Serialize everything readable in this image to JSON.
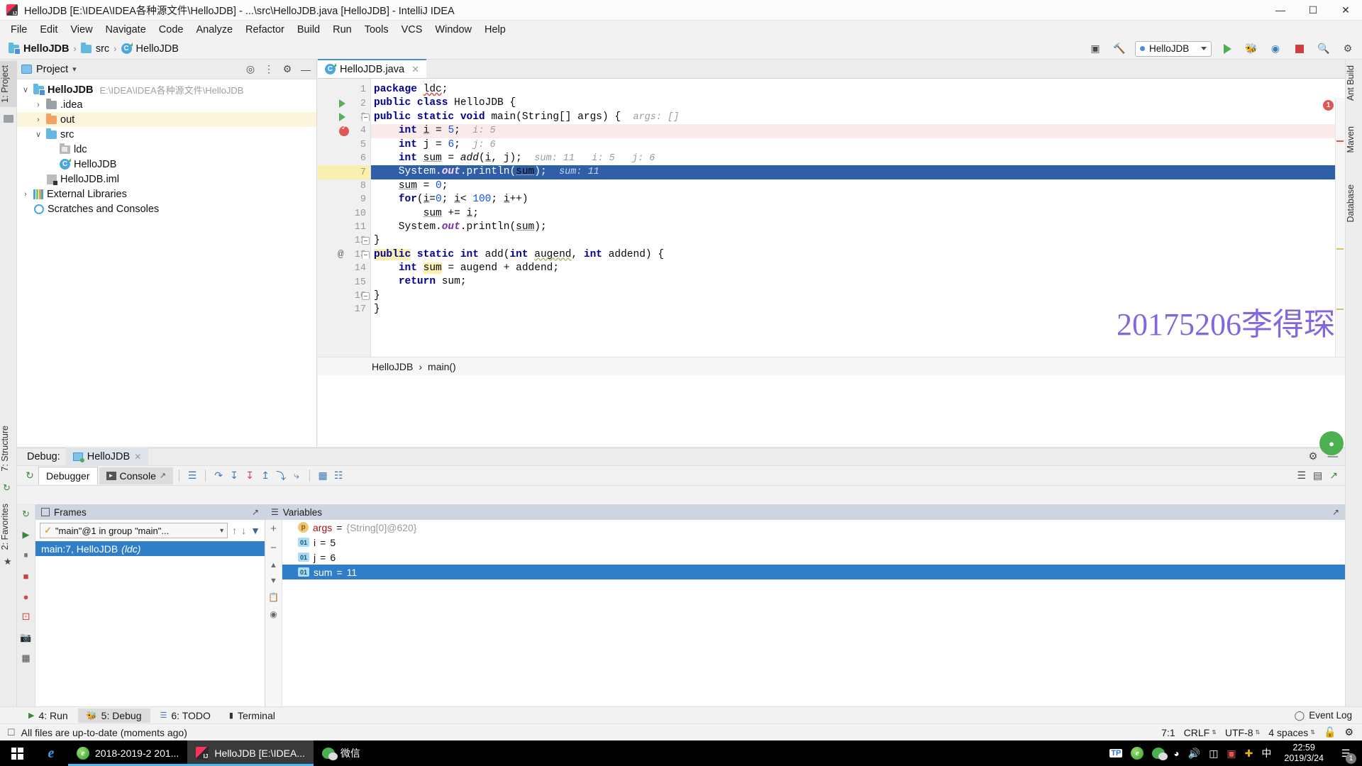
{
  "window": {
    "title": "HelloJDB [E:\\IDEA\\IDEA各种源文件\\HelloJDB] - ...\\src\\HelloJDB.java [HelloJDB] - IntelliJ IDEA",
    "minimize_label": "—",
    "maximize_label": "☐",
    "close_label": "✕"
  },
  "menubar": {
    "items": [
      "File",
      "Edit",
      "View",
      "Navigate",
      "Code",
      "Analyze",
      "Refactor",
      "Build",
      "Run",
      "Tools",
      "VCS",
      "Window",
      "Help"
    ]
  },
  "navbar": {
    "crumbs": [
      {
        "label": "HelloJDB",
        "icon": "module-folder-icon"
      },
      {
        "label": "src",
        "icon": "folder-icon"
      },
      {
        "label": "HelloJDB",
        "icon": "java-class-icon"
      }
    ],
    "separator": "›",
    "run_config": "HelloJDB",
    "icons": {
      "layout": "restore-layout-icon",
      "build": "hammer-icon",
      "run": "run-icon",
      "debug": "debug-icon",
      "coverage": "run-with-coverage-icon",
      "stop": "stop-icon",
      "search": "search-everywhere-icon",
      "settings": "settings-icon"
    }
  },
  "left_strip": {
    "project_label": "1: Project",
    "structure_label": "7: Structure",
    "favorites_label": "2: Favorites"
  },
  "right_strip": {
    "ant_label": "Ant Build",
    "maven_label": "Maven",
    "database_label": "Database"
  },
  "project_panel": {
    "title": "Project",
    "dropdown_caret": "▾",
    "header_icons": [
      "locate-icon",
      "collapse-all-icon",
      "gear-icon",
      "hide-icon"
    ],
    "tree": [
      {
        "label": "HelloJDB",
        "path": "E:\\IDEA\\IDEA各种源文件\\HelloJDB",
        "indent": 0,
        "arrow": "∨",
        "icon": "module-folder-icon",
        "bold": true,
        "highlight": false
      },
      {
        "label": ".idea",
        "path": "",
        "indent": 1,
        "arrow": "›",
        "icon": "folder-grey-icon",
        "bold": false,
        "highlight": false
      },
      {
        "label": "out",
        "path": "",
        "indent": 1,
        "arrow": "›",
        "icon": "folder-orange-icon",
        "bold": false,
        "highlight": true
      },
      {
        "label": "src",
        "path": "",
        "indent": 1,
        "arrow": "∨",
        "icon": "folder-blue-icon",
        "bold": false,
        "highlight": false
      },
      {
        "label": "ldc",
        "path": "",
        "indent": 2,
        "arrow": "",
        "icon": "package-icon",
        "bold": false,
        "highlight": false
      },
      {
        "label": "HelloJDB",
        "path": "",
        "indent": 2,
        "arrow": "",
        "icon": "java-class-icon",
        "bold": false,
        "highlight": false
      },
      {
        "label": "HelloJDB.iml",
        "path": "",
        "indent": 1,
        "arrow": "",
        "icon": "iml-file-icon",
        "bold": false,
        "highlight": false
      },
      {
        "label": "External Libraries",
        "path": "",
        "indent": 0,
        "arrow": "›",
        "icon": "library-icon",
        "bold": false,
        "highlight": false
      },
      {
        "label": "Scratches and Consoles",
        "path": "",
        "indent": 0,
        "arrow": "",
        "icon": "scratch-icon",
        "bold": false,
        "highlight": false
      }
    ]
  },
  "editor": {
    "tab_label": "HelloJDB.java",
    "tab_close": "✕",
    "error_count": "1",
    "watermark": "20175206李得琛",
    "breadcrumb": [
      "HelloJDB",
      "main()"
    ],
    "breadcrumb_sep": "›",
    "lines": [
      {
        "n": "1",
        "marker": "",
        "fold": "",
        "state": "normal"
      },
      {
        "n": "2",
        "marker": "run-gutter-icon",
        "fold": "",
        "state": "normal"
      },
      {
        "n": "3",
        "marker": "run-gutter-icon",
        "fold": "half",
        "state": "normal"
      },
      {
        "n": "4",
        "marker": "breakpoint-verified-icon",
        "fold": "",
        "state": "breakpoint"
      },
      {
        "n": "5",
        "marker": "",
        "fold": "",
        "state": "normal"
      },
      {
        "n": "6",
        "marker": "",
        "fold": "",
        "state": "normal"
      },
      {
        "n": "7",
        "marker": "",
        "fold": "",
        "state": "executing"
      },
      {
        "n": "8",
        "marker": "",
        "fold": "",
        "state": "normal"
      },
      {
        "n": "9",
        "marker": "",
        "fold": "",
        "state": "normal"
      },
      {
        "n": "10",
        "marker": "",
        "fold": "",
        "state": "normal"
      },
      {
        "n": "11",
        "marker": "",
        "fold": "",
        "state": "normal"
      },
      {
        "n": "12",
        "marker": "",
        "fold": "end",
        "state": "normal"
      },
      {
        "n": "13",
        "marker": "@",
        "fold": "half",
        "state": "normal"
      },
      {
        "n": "14",
        "marker": "",
        "fold": "",
        "state": "normal"
      },
      {
        "n": "15",
        "marker": "",
        "fold": "",
        "state": "normal"
      },
      {
        "n": "16",
        "marker": "",
        "fold": "end",
        "state": "normal"
      },
      {
        "n": "17",
        "marker": "",
        "fold": "",
        "state": "normal"
      }
    ],
    "source": {
      "l1": "package ldc;",
      "l2": "public class HelloJDB {",
      "l3": "public static void main(String[] args) {",
      "l3_hint": "args: []",
      "l4": "int i = 5;",
      "l4_hint": "i: 5",
      "l5": "int j = 6;",
      "l5_hint": "j: 6",
      "l6": "int sum = add(i, j);",
      "l6_hint": "sum: 11   i: 5   j: 6",
      "l7": "System.out.println(sum);",
      "l7_hint": "sum: 11",
      "l8": "sum = 0;",
      "l9": "for(i=0; i< 100; i++)",
      "l10": "sum += i;",
      "l11": "System.out.println(sum);",
      "l12": "}",
      "l13": "public static int add(int augend, int addend) {",
      "l14": "int sum = augend + addend;",
      "l15": "return sum;",
      "l16": "}",
      "l17": "}"
    }
  },
  "debug": {
    "header_label": "Debug:",
    "session_tab": "HelloJDB",
    "session_close": "✕",
    "tabs": [
      {
        "label": "Debugger",
        "active": true,
        "icon": "debugger-icon"
      },
      {
        "label": "Console",
        "active": false,
        "icon": "console-icon"
      }
    ],
    "toolbar_icons": [
      "rerun-icon",
      "mute-breakpoints-icon",
      "step-over-icon",
      "step-into-icon",
      "force-step-into-icon",
      "step-out-icon",
      "drop-frame-icon",
      "run-to-cursor-icon",
      "evaluate-expression-icon",
      "layout-icon"
    ],
    "settings_icon": "settings-icon",
    "hide_icon": "hide-icon",
    "side_icons": [
      "rerun-icon",
      "resume-icon",
      "pause-icon",
      "stop-icon",
      "view-breakpoints-icon",
      "mute-breakpoints-icon",
      "screenshot-icon",
      "layers-icon"
    ],
    "frames": {
      "title": "Frames",
      "thread": "\"main\"@1 in group \"main\"...",
      "thread_caret": "∨",
      "check_icon": "checkmark-icon",
      "nav_icons": [
        "arrow-up-icon",
        "arrow-down-icon",
        "filter-icon"
      ],
      "rows": [
        {
          "label": "main:7, HelloJDB",
          "module": "(ldc)",
          "selected": true
        }
      ]
    },
    "variables": {
      "title": "Variables",
      "side_buttons": [
        "plus-icon",
        "minus-icon",
        "arrow-up-icon",
        "arrow-down-icon",
        "copy-icon",
        "watch-icon"
      ],
      "rows": [
        {
          "icon": "p",
          "name": "args",
          "eq": "=",
          "value": "{String[0]@620}",
          "selected": false
        },
        {
          "icon": "01",
          "name": "i",
          "eq": "=",
          "value": "5",
          "selected": false
        },
        {
          "icon": "01",
          "name": "j",
          "eq": "=",
          "value": "6",
          "selected": false
        },
        {
          "icon": "01",
          "name": "sum",
          "eq": "=",
          "value": "11",
          "selected": true
        }
      ]
    }
  },
  "bottom_tabs": {
    "items": [
      {
        "label": "4: Run",
        "active": false,
        "icon": "run-icon"
      },
      {
        "label": "5: Debug",
        "active": true,
        "icon": "debug-icon"
      },
      {
        "label": "6: TODO",
        "active": false,
        "icon": "todo-icon"
      },
      {
        "label": "Terminal",
        "active": false,
        "icon": "terminal-icon"
      }
    ],
    "event_log": "Event Log",
    "event_log_icon": "event-log-icon"
  },
  "statusbar": {
    "message": "All files are up-to-date (moments ago)",
    "message_icon": "file-icon",
    "caret_position": "7:1",
    "line_separator": "CRLF",
    "encoding": "UTF-8",
    "indent": "4 spaces",
    "lock_icon": "unlocked-icon",
    "inspection_icon": "inspector-icon",
    "spinner": "⇅"
  },
  "taskbar": {
    "start_icon": "windows-start-icon",
    "edge_icon": "edge-icon",
    "items": [
      {
        "label": "2018-2019-2 201...",
        "icon": "browser-icon",
        "active": false,
        "running": true
      },
      {
        "label": "HelloJDB [E:\\IDEA...",
        "icon": "intellij-icon",
        "active": true,
        "running": true
      },
      {
        "label": "微信",
        "icon": "wechat-icon",
        "active": false,
        "running": false
      }
    ],
    "tray_icons": [
      "tp-link-icon",
      "browser-icon",
      "wechat-icon",
      "wifi-icon",
      "volume-icon",
      "battery-icon",
      "display-icon",
      "update-icon",
      "ime-chinese-icon"
    ],
    "ime_label": "中",
    "clock_time": "22:59",
    "clock_date": "2019/3/24",
    "notification_badge": "1",
    "notification_icon": "notification-icon"
  },
  "colors": {
    "accent": "#4a90d9",
    "selection": "#2f5fa8",
    "breakpoint": "#e05555",
    "run_green": "#4caf50",
    "watermark": "#7c5fe0",
    "keyword": "#00008f"
  }
}
